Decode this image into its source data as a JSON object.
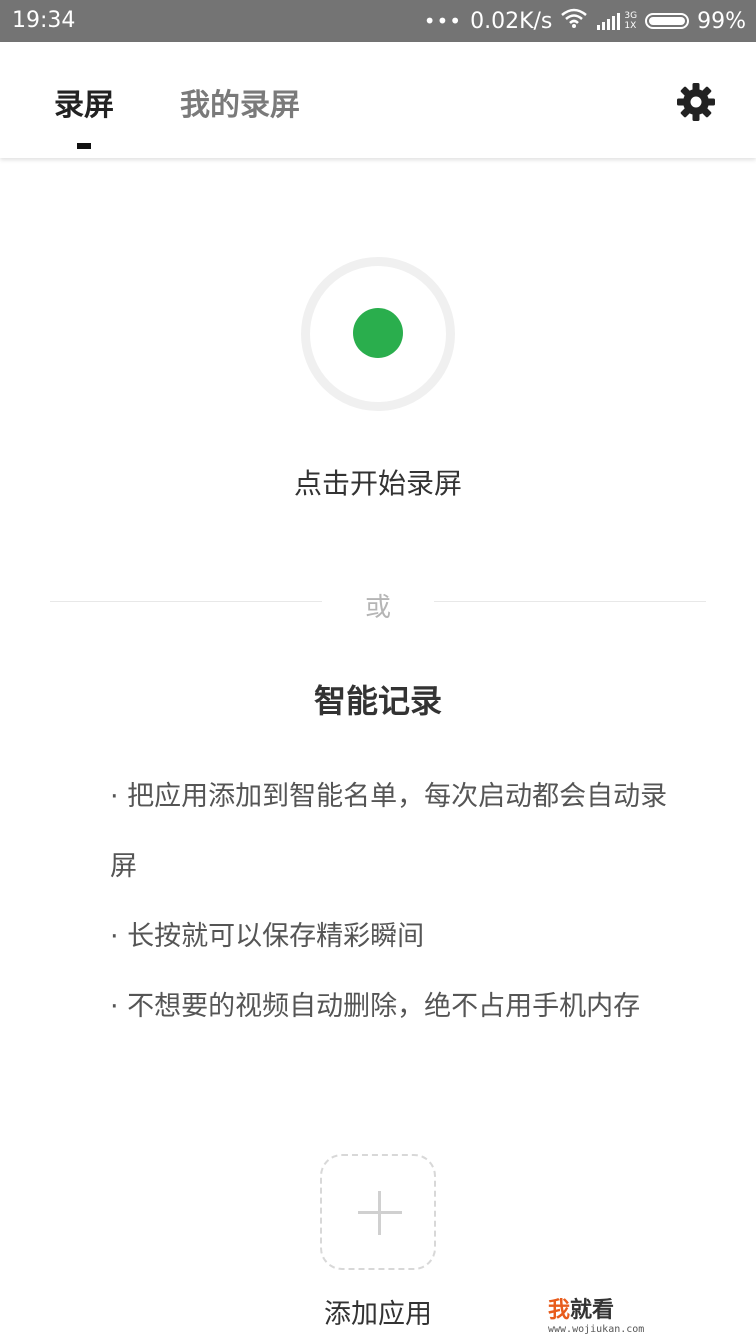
{
  "status_bar": {
    "time": "19:34",
    "dots": "•••",
    "net_speed": "0.02K/s",
    "net_top": "3G",
    "net_bottom": "1X",
    "battery": "99%",
    "battery_level": 0.99
  },
  "header": {
    "tabs": [
      {
        "label": "录屏",
        "active": true
      },
      {
        "label": "我的录屏",
        "active": false
      }
    ],
    "settings_icon": "gear-icon"
  },
  "record": {
    "label": "点击开始录屏",
    "dot_color": "#2aae4d"
  },
  "divider": {
    "or_text": "或"
  },
  "smart_record": {
    "title": "智能记录",
    "items": [
      "· 把应用添加到智能名单，每次启动都会自动录屏",
      "· 长按就可以保存精彩瞬间",
      "· 不想要的视频自动删除，绝不占用手机内存"
    ]
  },
  "add_app": {
    "label": "添加应用",
    "icon": "plus-icon"
  },
  "watermark": {
    "wo": "我",
    "rest": "就看",
    "url": "www.wojiukan.com"
  }
}
